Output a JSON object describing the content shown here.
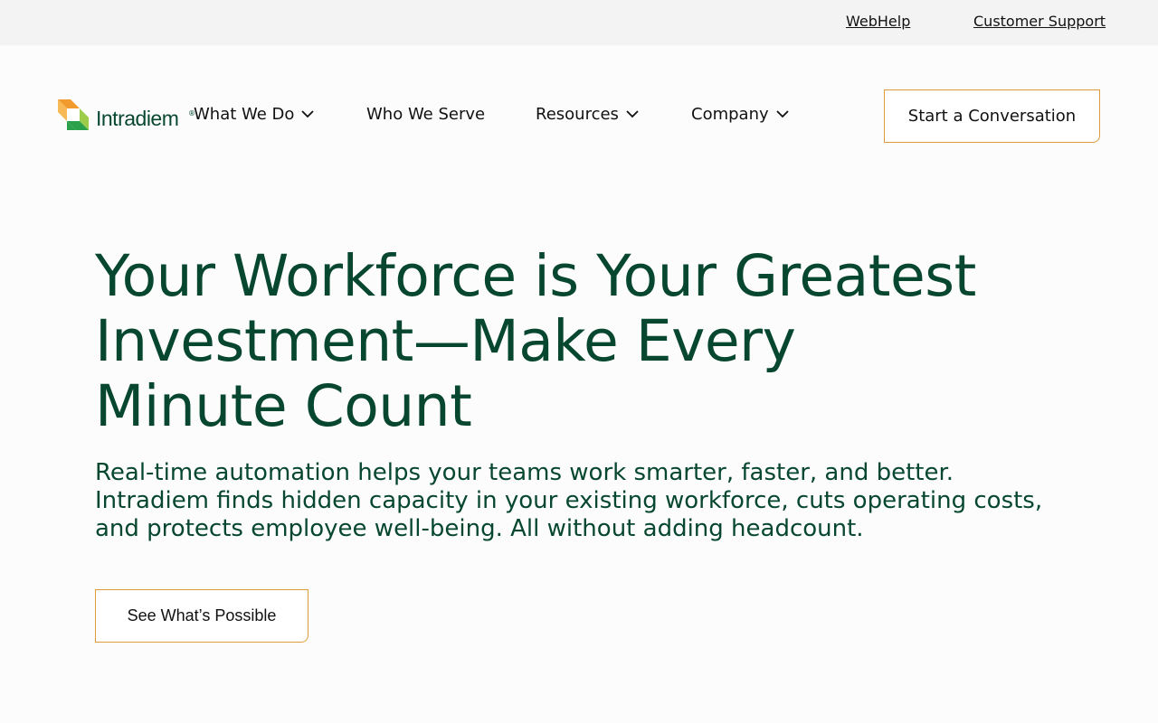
{
  "utility": {
    "webhelp": "WebHelp",
    "support": "Customer Support"
  },
  "brand": {
    "name": "Intradiem",
    "reg": "®",
    "colors": {
      "orange": "#f19a2e",
      "lime": "#9ccc4a",
      "green": "#2aa14a",
      "dark": "#07472f"
    }
  },
  "nav": {
    "items": [
      {
        "label": "What We Do",
        "has_dropdown": true
      },
      {
        "label": "Who We Serve",
        "has_dropdown": false
      },
      {
        "label": "Resources",
        "has_dropdown": true
      },
      {
        "label": "Company",
        "has_dropdown": true
      }
    ],
    "cta": "Start a Conversation"
  },
  "hero": {
    "title": "Your Workforce is Your Greatest Investment—Make Every Minute Count",
    "subtitle": "Real-time automation helps your teams work smarter, faster, and better. Intradiem finds hidden capacity in your existing workforce, cuts operating costs, and protects employee well-being. All without adding headcount.",
    "cta": "See What’s Possible"
  },
  "colors": {
    "heading": "#07472f",
    "button_border": "#e09a3b",
    "utility_bg": "#f3f3f3"
  }
}
